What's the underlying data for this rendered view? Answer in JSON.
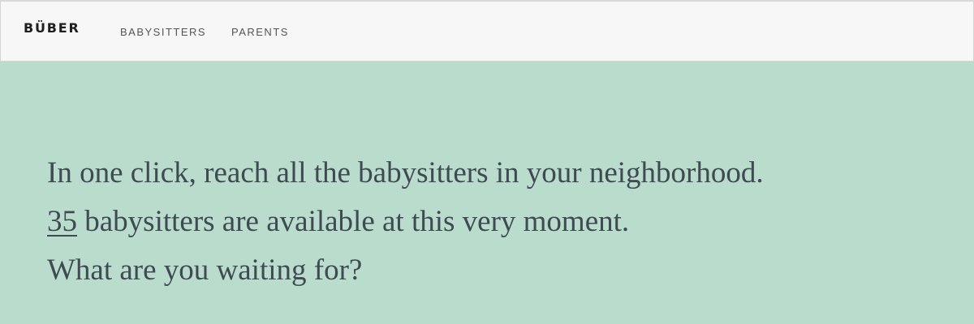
{
  "header": {
    "brand": "BÜBER",
    "nav": [
      {
        "label": "BABYSITTERS"
      },
      {
        "label": "PARENTS"
      }
    ]
  },
  "hero": {
    "line1": "In one click, reach all the babysitters in your neighborhood.",
    "count": "35",
    "line2_rest": " babysitters are available at this very moment.",
    "line3": "What are you waiting for?"
  },
  "colors": {
    "hero_background": "#b9dccd",
    "navbar_background": "#f7f7f7",
    "text": "#3f4a52"
  }
}
